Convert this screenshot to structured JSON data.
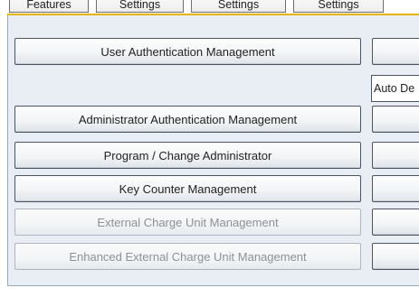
{
  "tabs": [
    {
      "label": "Features"
    },
    {
      "label": "Settings"
    },
    {
      "label": "Settings"
    },
    {
      "label": "Settings"
    }
  ],
  "left_buttons": [
    {
      "label": "User Authentication Management",
      "enabled": true
    },
    {
      "label": "Administrator Authentication Management",
      "enabled": true
    },
    {
      "label": "Program / Change Administrator",
      "enabled": true
    },
    {
      "label": "Key Counter Management",
      "enabled": true
    },
    {
      "label": "External Charge Unit Management",
      "enabled": false
    },
    {
      "label": "Enhanced External Charge Unit Management",
      "enabled": false
    }
  ],
  "right_column": {
    "field_label": "Auto De"
  },
  "colors": {
    "accent": "#e9b400",
    "panel_bg": "#e8eef4",
    "disabled_text": "#8c9196"
  }
}
